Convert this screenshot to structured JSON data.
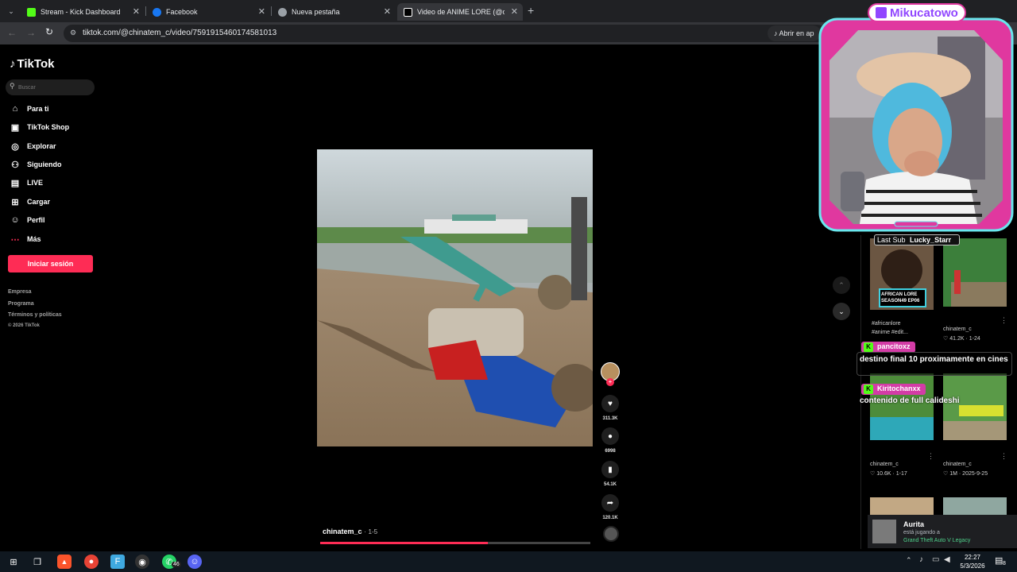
{
  "browser": {
    "tabs": [
      {
        "label": "Stream - Kick Dashboard",
        "favicon_color": "#53fc18"
      },
      {
        "label": "Facebook",
        "favicon_color": "#1877f2"
      },
      {
        "label": "Nueva pestaña",
        "favicon_color": "#9aa0a6"
      },
      {
        "label": "Video de ANIME LORE (@china",
        "favicon_color": "#ffffff"
      }
    ],
    "active_tab_index": 3,
    "url": "tiktok.com/@chinatem_c/video/7591915460174581013",
    "open_in_app": "Abrir en ap"
  },
  "tiktok": {
    "logo": "TikTok",
    "search_placeholder": "Buscar",
    "nav": [
      {
        "label": "Para ti",
        "icon": "home-icon"
      },
      {
        "label": "TikTok Shop",
        "icon": "shop-icon"
      },
      {
        "label": "Explorar",
        "icon": "compass-icon"
      },
      {
        "label": "Siguiendo",
        "icon": "following-icon"
      },
      {
        "label": "LIVE",
        "icon": "live-icon"
      },
      {
        "label": "Cargar",
        "icon": "upload-icon"
      },
      {
        "label": "Perfil",
        "icon": "profile-icon"
      },
      {
        "label": "Más",
        "icon": "more-icon"
      }
    ],
    "login_button": "Iniciar sesión",
    "accent": "#fe2c55",
    "footer": [
      "Empresa",
      "Programa",
      "Términos y políticas",
      "© 2026 TikTok"
    ],
    "video": {
      "author": "chinatem_c",
      "date": "1-5",
      "progress": 0.62
    },
    "actions": {
      "likes": "311.3K",
      "comments": "6998",
      "saves": "54.1K",
      "shares": "120.1K"
    },
    "related": [
      {
        "caption": "#africanlore #anime #edit...",
        "overlay": "AFRICAN LORE SEASON49 EP06",
        "author": "",
        "stats": ""
      },
      {
        "caption": "",
        "overlay": "",
        "author": "chinatem_c",
        "stats": "41.2K · 1-24"
      },
      {
        "caption": "",
        "overlay": "",
        "author": "chinatem_c",
        "stats": "10.6K · 1-17"
      },
      {
        "caption": "",
        "overlay": "",
        "author": "chinatem_c",
        "stats": "1M · 2025-9-25"
      }
    ]
  },
  "stream_overlay": {
    "streamer": "Mikucatowo",
    "last_sub_label": "Last Sub",
    "last_sub_name": "Lucky_Starr",
    "chat": [
      {
        "user": "pancitoxz",
        "message": "destino final 10 proximamente en cines"
      },
      {
        "user": "Kiritochanxx",
        "message": "contenido de full calideshi"
      }
    ]
  },
  "notification": {
    "name": "Aurita",
    "status": "está jugando a",
    "game": "Grand Theft Auto V Legacy"
  },
  "taskbar": {
    "time": "22:27",
    "date": "5/3/2026",
    "whatsapp_badge": "46",
    "notif_count": "8"
  }
}
